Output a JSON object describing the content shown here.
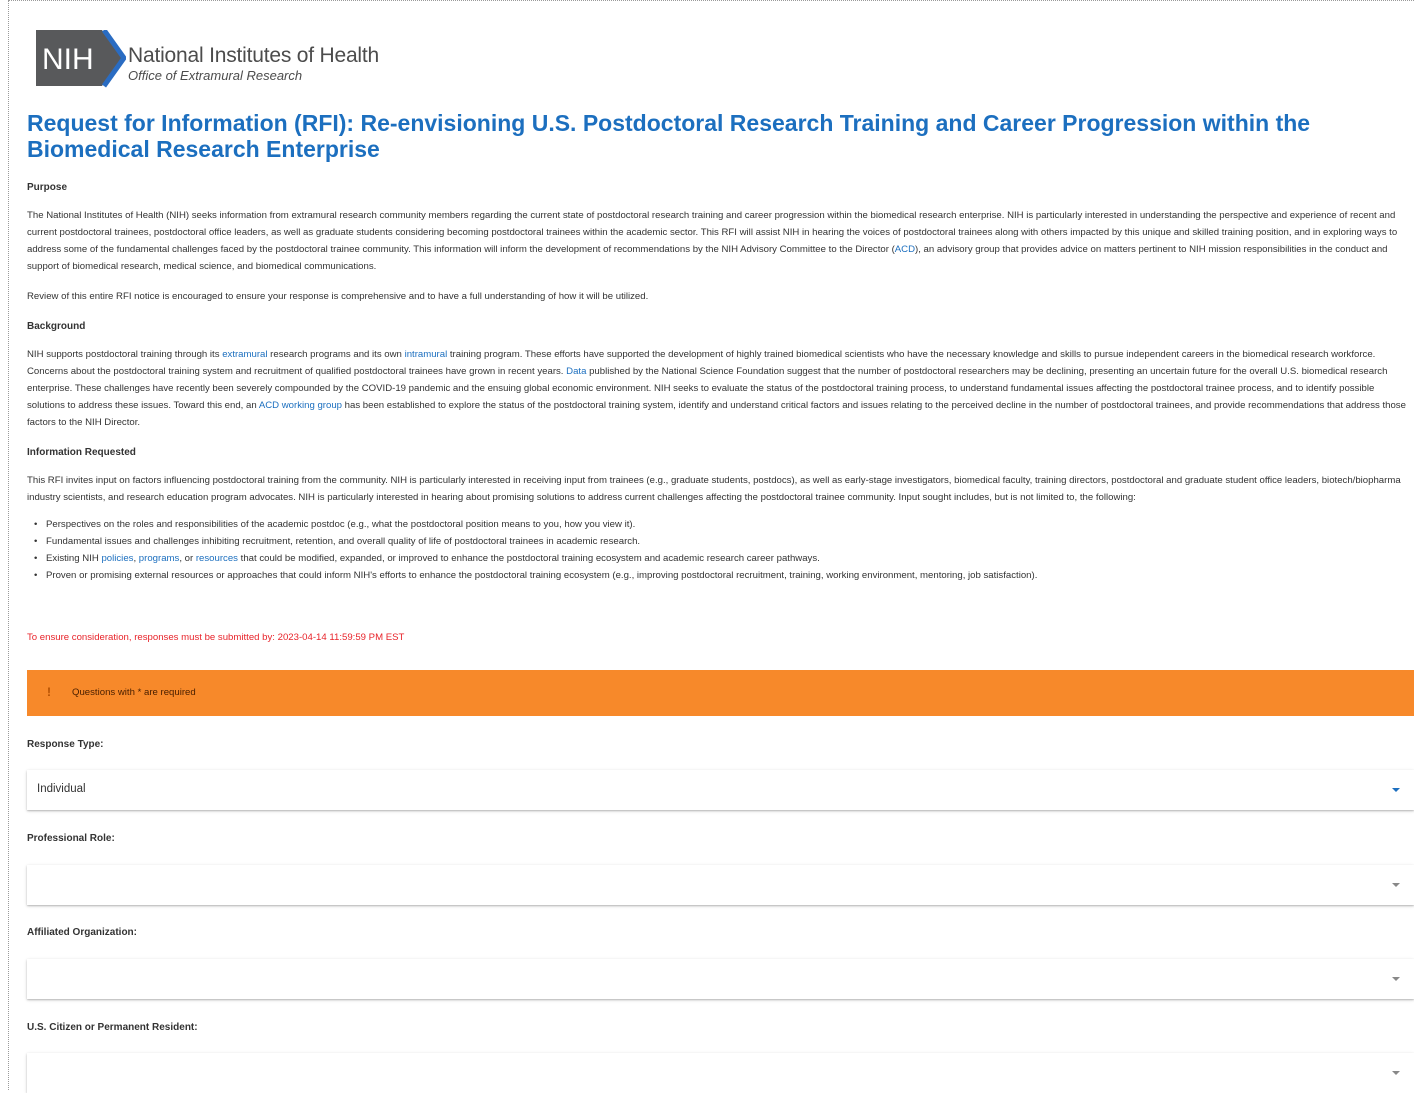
{
  "logo": {
    "mark": "NIH",
    "title": "National Institutes of Health",
    "subtitle": "Office of Extramural Research"
  },
  "page_title": "Request for Information (RFI): Re-envisioning U.S. Postdoctoral Research Training and Career Progression within the Biomedical Research Enterprise",
  "purpose": {
    "heading": "Purpose",
    "p1_a": "The National Institutes of Health (NIH) seeks information from extramural research community members regarding the current state of postdoctoral research training and career progression within the biomedical research enterprise. NIH is particularly interested in understanding the perspective and experience of recent and current postdoctoral trainees, postdoctoral office leaders, as well as graduate students considering becoming postdoctoral trainees within the academic sector. This RFI will assist NIH in hearing the voices of postdoctoral trainees along with others impacted by this unique and skilled training position, and in exploring ways to address some of the fundamental challenges faced by the postdoctoral trainee community. This information will inform the development of recommendations by the NIH Advisory Committee to the Director (",
    "p1_link": "ACD",
    "p1_b": "), an advisory group that provides advice on matters pertinent to NIH mission responsibilities in the conduct and support of biomedical research, medical science, and biomedical communications.",
    "p2": "Review of this entire RFI notice is encouraged to ensure your response is comprehensive and to have a full understanding of how it will be utilized."
  },
  "background": {
    "heading": "Background",
    "t1": "NIH supports postdoctoral training through its ",
    "l1": "extramural",
    "t2": " research programs and its own ",
    "l2": "intramural",
    "t3": " training program. These efforts have supported the development of highly trained biomedical scientists who have the necessary knowledge and skills to pursue independent careers in the biomedical research workforce. Concerns about the postdoctoral training system and recruitment of qualified postdoctoral trainees have grown in recent years. ",
    "l3": "Data",
    "t4": " published by the National Science Foundation suggest that the number of postdoctoral researchers may be declining, presenting an uncertain future for the overall U.S. biomedical research enterprise. These challenges have recently been severely compounded by the COVID-19 pandemic and the ensuing global economic environment. NIH seeks to evaluate the status of the postdoctoral training process, to understand fundamental issues affecting the postdoctoral trainee process, and to identify possible solutions to address these issues. Toward this end, an ",
    "l4": "ACD working group",
    "t5": " has been established to explore the status of the postdoctoral training system, identify and understand critical factors and issues relating to the perceived decline in the number of postdoctoral trainees, and provide recommendations that address those factors to the NIH Director."
  },
  "information": {
    "heading": "Information Requested",
    "intro": "This RFI invites input on factors influencing postdoctoral training from the community. NIH is particularly interested in receiving input from trainees (e.g., graduate students, postdocs), as well as early-stage investigators, biomedical faculty, training directors, postdoctoral and graduate student office leaders, biotech/biopharma industry scientists, and research education program advocates. NIH is particularly interested in hearing about promising solutions to address current challenges affecting the postdoctoral trainee community. Input sought includes, but is not limited to, the following:",
    "bullet1": "Perspectives on the roles and responsibilities of the academic postdoc (e.g., what the postdoctoral position means to you, how you view it).",
    "bullet2": "Fundamental issues and challenges inhibiting recruitment, retention, and overall quality of life of postdoctoral trainees in academic research.",
    "bullet3_a": "Existing NIH ",
    "bullet3_l1": "policies",
    "bullet3_s1": ", ",
    "bullet3_l2": "programs",
    "bullet3_s2": ", or ",
    "bullet3_l3": "resources",
    "bullet3_b": " that could be modified, expanded, or improved to enhance the postdoctoral training ecosystem and academic research career pathways.",
    "bullet4": "Proven or promising external resources or approaches that could inform NIH's efforts to enhance the postdoctoral training ecosystem (e.g., improving postdoctoral recruitment, training, working environment, mentoring, job satisfaction)."
  },
  "deadline": "To ensure consideration, responses must be submitted by: 2023-04-14 11:59:59 PM EST",
  "required_notice": {
    "icon": "!",
    "text": "Questions with * are required"
  },
  "form": {
    "response_type": {
      "label": "Response Type:",
      "value": "Individual"
    },
    "professional_role": {
      "label": "Professional Role:",
      "value": ""
    },
    "affiliated_org": {
      "label": "Affiliated Organization:",
      "value": ""
    },
    "citizen": {
      "label": "U.S. Citizen or Permanent Resident:",
      "value": ""
    }
  },
  "colors": {
    "link": "#1c6fbf",
    "title": "#1c6fbf",
    "deadline": "#e8232a",
    "warning_bg": "#f7892a",
    "logo_mark_bg": "#58595b"
  }
}
